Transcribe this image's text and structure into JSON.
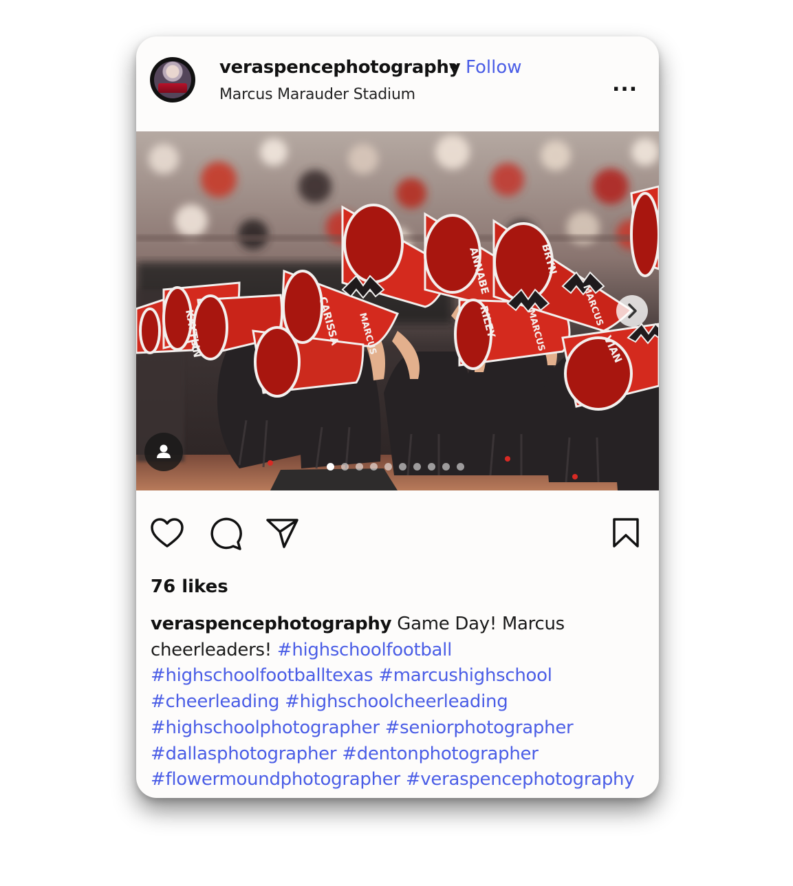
{
  "post": {
    "username": "veraspencephotography",
    "separator": "•",
    "follow_label": "Follow",
    "location": "Marcus Marauder Stadium",
    "more_label": "...",
    "likes": "76 likes"
  },
  "caption": {
    "username": "veraspencephotography",
    "lines": [
      "Game Day! Marcus",
      "cheerleaders! "
    ],
    "hashtags": [
      "#highschoolfootball",
      "#highschoolfootballtexas",
      "#marcushighschool",
      "#cheerleading",
      "#highschoolcheerleading",
      "#highschoolphotographer",
      "#seniorphotographer",
      "#dallasphotographer",
      "#dentonphotographer",
      "#flowermoundphotographer",
      "#veraspencephotography"
    ]
  },
  "photo": {
    "megaphone_names": [
      "KAYTLIN",
      "CARISSA",
      "ANNABE",
      "RILEY",
      "BRYN",
      "VIAN"
    ],
    "megaphone_text": "MARCUS",
    "carousel": {
      "count": 10,
      "active_index": 0
    }
  },
  "icons": [
    "heart-icon",
    "comment-icon",
    "share-icon",
    "bookmark-icon",
    "person-icon",
    "chevron-right-icon"
  ],
  "colors": {
    "accent": "#4a5de6",
    "card": "#fdfcfb",
    "megaphone_red": "#d42a1e",
    "uniform": "#2a2628"
  }
}
